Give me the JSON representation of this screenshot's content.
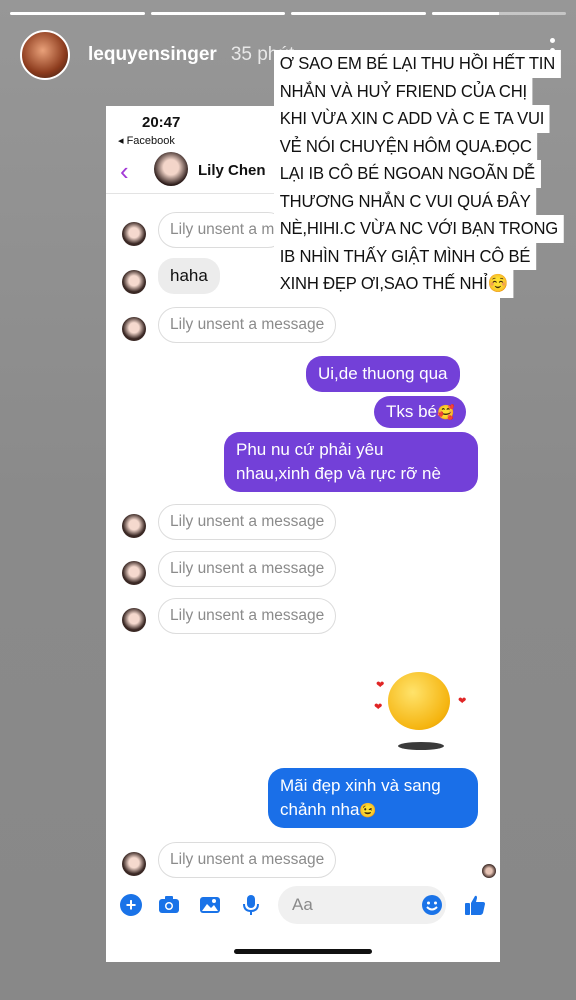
{
  "story": {
    "progress": [
      1,
      1,
      1,
      0.5
    ],
    "username": "lequyensinger",
    "time": "35 phút",
    "overlay_lines": [
      "Ơ SAO EM BÉ LẠI THU HỒI HẾT TIN",
      "NHẮN VÀ HUỶ FRIEND CỦA CHỊ",
      "KHI VỪA XIN C ADD VÀ C E TA VUI",
      "VẺ NÓI CHUYỆN HÔM QUA.ĐỌC",
      "LẠI IB CÔ BÉ NGOAN NGOÃN DỄ",
      "THƯƠNG NHẮN C VUI QUÁ ĐÂY",
      "NÈ,HIHI.C VỪA NC VỚI BẠN TRONG",
      "IB NHÌN THẤY GIẬT MÌNH CÔ BÉ",
      "XINH ĐẸP ƠI,SAO THẾ NHỈ☺️"
    ]
  },
  "phone": {
    "status_time": "20:47",
    "back_app": "◂ Facebook",
    "contact_name": "Lily Chen",
    "messages": {
      "unsent_label_partial": "Lily unsent a m",
      "haha": "haha",
      "unsent_label": "Lily unsent a message",
      "out1": "Ui,de thuong qua",
      "out2_text": "Tks bé",
      "out2_emoji": "🥰",
      "out3_line1": "Phu nu cứ phải yêu",
      "out3_line2": "nhau,xinh đẹp và rực rỡ nè",
      "out4_line1": "Mãi đẹp xinh và sang",
      "out4_line2": "chảnh nha",
      "out4_emoji": "😉"
    },
    "composer_placeholder": "Aa"
  },
  "colors": {
    "purple_bubble": "#7340d8",
    "blue_bubble": "#1a6fe8",
    "accent": "#a33ad6",
    "icon_blue": "#1a73e8"
  }
}
